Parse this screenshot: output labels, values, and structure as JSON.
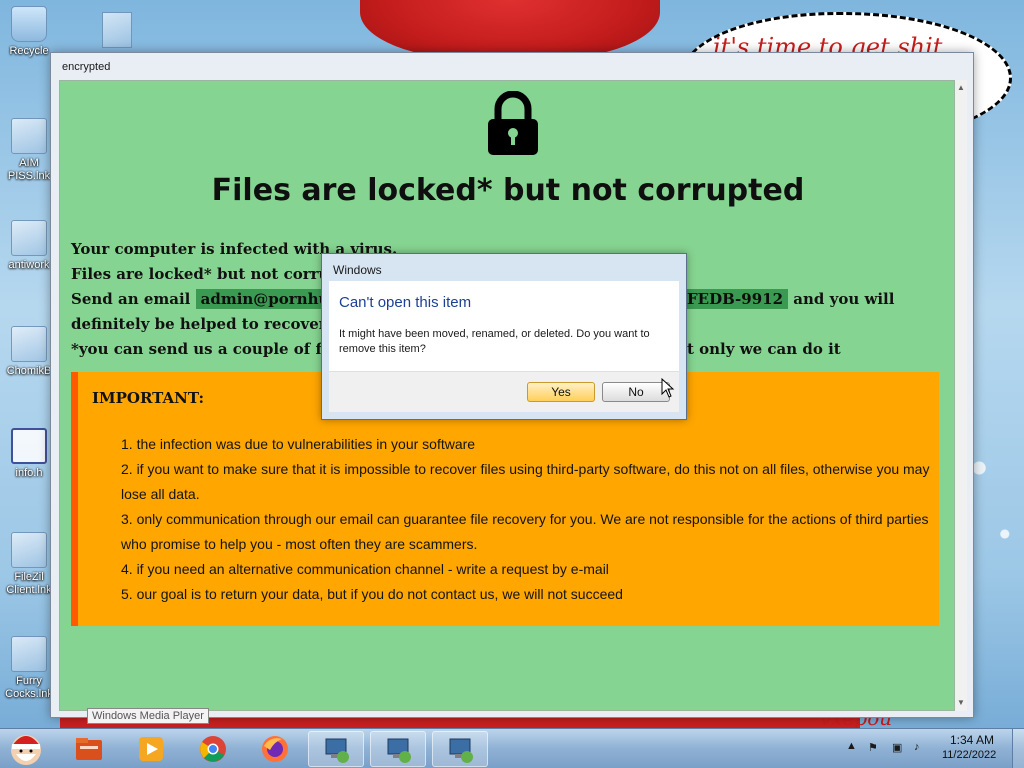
{
  "desktop": {
    "background_text": {
      "bubble": "it's time to get shit",
      "bottom": "vxepou"
    },
    "icons": [
      {
        "label": "Recycle",
        "name": "recycle-bin"
      },
      {
        "label": "AIM\nPISS.lnk",
        "name": "aim-piss-shortcut"
      },
      {
        "label": "antiwork",
        "name": "antiwork-shortcut"
      },
      {
        "label": "ChomikB",
        "name": "chomikb-shortcut"
      },
      {
        "label": "info.h",
        "name": "info-file"
      },
      {
        "label": "FileZil\nClient.lnk",
        "name": "filezilla-shortcut"
      },
      {
        "label": "Furry\nCocks.lnk",
        "name": "furry-cocks-shortcut"
      }
    ]
  },
  "window": {
    "title": "encrypted",
    "headline": "Files are locked* but not corrupted",
    "lines": [
      "Your computer is infected with a virus.",
      "Files are locked* but not corrupte",
      "Send an email",
      "definitely be helped to recover.",
      "*you can send us a couple of files"
    ],
    "email": "admin@pornhub.co",
    "id_code": "FEDB-9912",
    "after_code": "and you will",
    "line5_end": "t only we can do it",
    "important": {
      "title": "IMPORTANT:",
      "items": [
        "1. the infection was due to vulnerabilities in your software",
        "2. if you want to make sure that it is impossible to recover files using third-party software, do this not on all files, otherwise you may lose all data.",
        "3. only communication through our email can guarantee file recovery for you. We are not responsible for the actions of third parties who promise to help you - most often they are scammers.",
        "4. if you need an alternative communication channel - write a request by e-mail",
        "5. our goal is to return your data, but if you do not contact us, we will not succeed"
      ]
    }
  },
  "dialog": {
    "title": "Windows",
    "heading": "Can't open this item",
    "message": "It might have been moved, renamed, or deleted. Do you want to remove this item?",
    "yes_label": "Yes",
    "no_label": "No"
  },
  "tooltip": "Windows Media Player",
  "taskbar": {
    "buttons": [
      "santa-start",
      "file-manager",
      "media-player",
      "chrome",
      "firefox",
      "vm-1",
      "vm-2",
      "vm-3"
    ],
    "clock_time": "1:34 AM",
    "clock_date": "11/22/2022"
  },
  "colors": {
    "window_bg": "#86d491",
    "highlight": "#3a9a52",
    "important_bg": "#ffa600",
    "important_border": "#ff5a00",
    "dialog_heading": "#1f3f96"
  }
}
